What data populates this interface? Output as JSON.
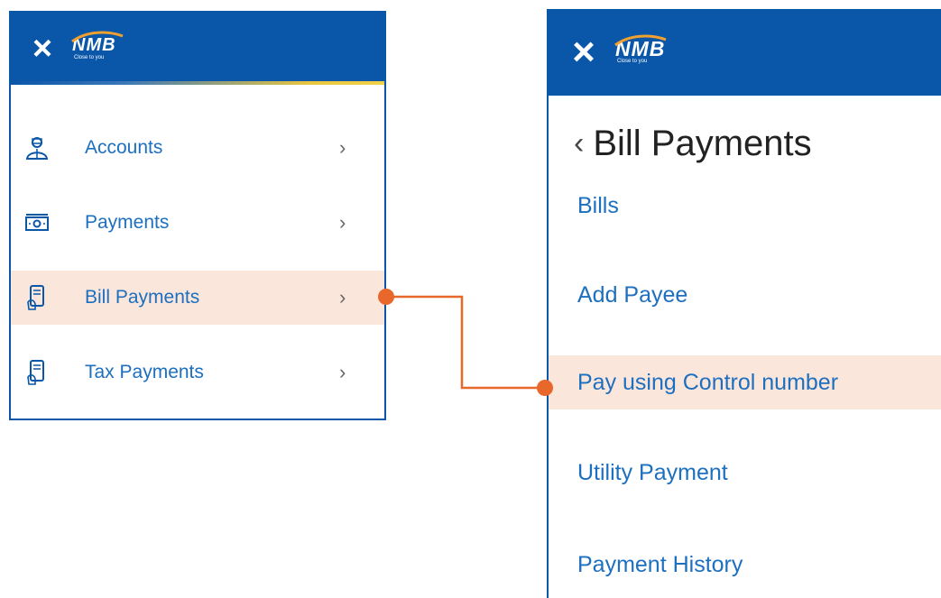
{
  "left_panel": {
    "close_icon": "×",
    "logo": {
      "word": "NMB",
      "tagline": "Close to you"
    },
    "items": [
      {
        "label": "Accounts",
        "icon": "accounts-icon",
        "chevron": "›"
      },
      {
        "label": "Payments",
        "icon": "payments-icon",
        "chevron": "›"
      },
      {
        "label": "Bill Payments",
        "icon": "bill-payments-icon",
        "chevron": "›",
        "active": true
      },
      {
        "label": "Tax Payments",
        "icon": "tax-payments-icon",
        "chevron": "›"
      }
    ]
  },
  "right_panel": {
    "close_icon": "×",
    "logo": {
      "word": "NMB",
      "tagline": "Close to you"
    },
    "back_icon": "‹",
    "title": "Bill Payments",
    "items": [
      {
        "label": "Bills"
      },
      {
        "label": "Add Payee"
      },
      {
        "label": "Pay using Control number",
        "active": true
      },
      {
        "label": "Utility Payment"
      },
      {
        "label": "Payment History"
      }
    ]
  },
  "colors": {
    "brand_blue": "#0a56a8",
    "link_blue": "#1d6fbf",
    "highlight": "#fbe6dc",
    "connector_orange": "#e8672a",
    "logo_swoosh": "#f0a030"
  }
}
